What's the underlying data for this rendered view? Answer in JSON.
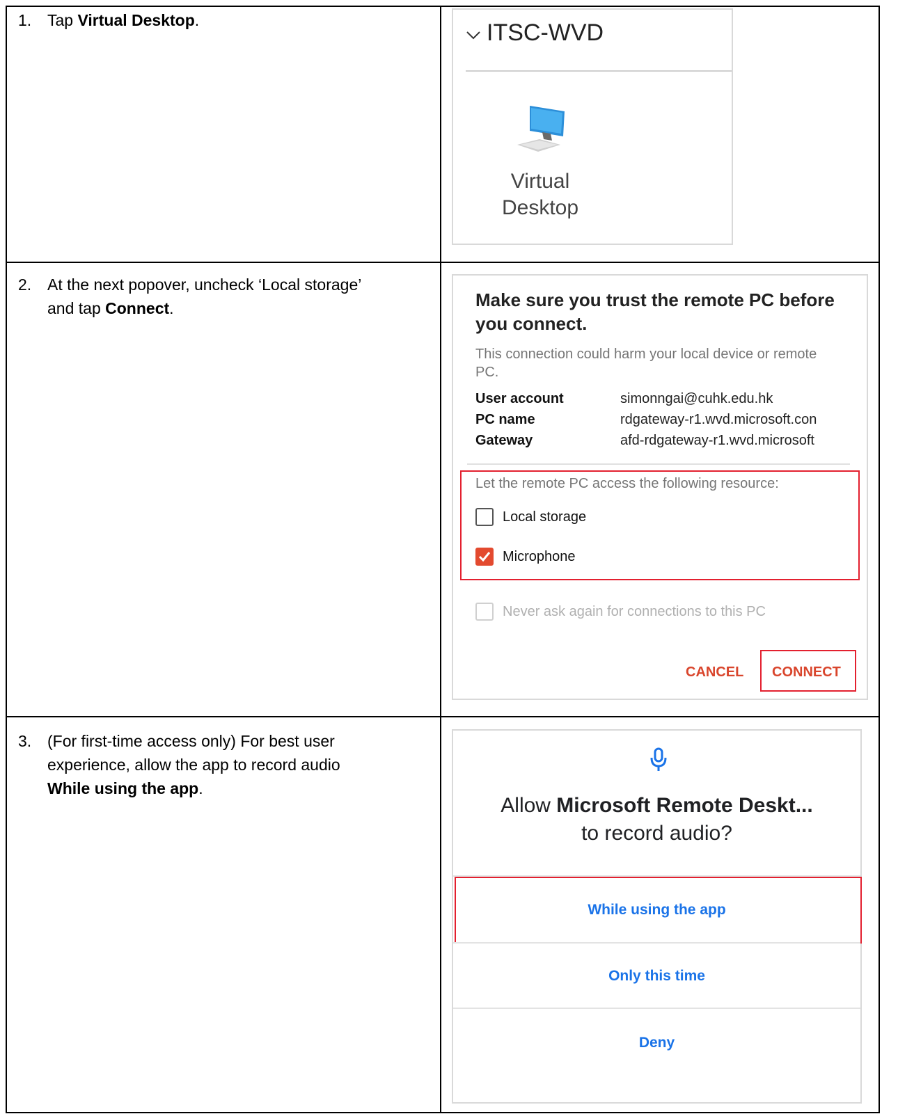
{
  "steps": [
    {
      "num": "1.",
      "pre": "Tap ",
      "bold": "Virtual Desktop",
      "post": "."
    },
    {
      "num": "2.",
      "line1": "At the next popover, uncheck ‘Local storage’",
      "line2_pre": "and tap ",
      "line2_bold": "Connect",
      "line2_post": "."
    },
    {
      "num": "3.",
      "line1": "(For first-time access only) For best user",
      "line2": "experience, allow the app to record audio",
      "line3_bold": "While using the app",
      "line3_post": "."
    }
  ],
  "panel1": {
    "group_title": "ITSC-WVD",
    "chevron_icon": "chevron-down-icon",
    "desktop_icon": "monitor-icon",
    "tile_label_1": "Virtual",
    "tile_label_2": "Desktop"
  },
  "panel2": {
    "title": "Make sure you trust the remote PC before you connect.",
    "warning": "This connection could harm your local device or remote PC.",
    "details": [
      {
        "key": "User account",
        "value": "simonngai@cuhk.edu.hk"
      },
      {
        "key": "PC name",
        "value": "rdgateway-r1.wvd.microsoft.con"
      },
      {
        "key": "Gateway",
        "value": "afd-rdgateway-r1.wvd.microsoft"
      }
    ],
    "resource_prompt": "Let the remote PC access the following resource:",
    "local_storage_label": "Local storage",
    "local_storage_checked": false,
    "microphone_label": "Microphone",
    "microphone_checked": true,
    "never_ask_label": "Never ask again for connections to this PC",
    "cancel_label": "CANCEL",
    "connect_label": "CONNECT",
    "accent_color": "#d9452c",
    "highlight_color": "#e3202f"
  },
  "panel3": {
    "mic_icon": "microphone-icon",
    "question_pre": "Allow ",
    "question_bold": "Microsoft Remote Deskt...",
    "question_line2": "to record audio?",
    "options": [
      "While using the app",
      "Only this time",
      "Deny"
    ],
    "option_color": "#1a73e8"
  }
}
